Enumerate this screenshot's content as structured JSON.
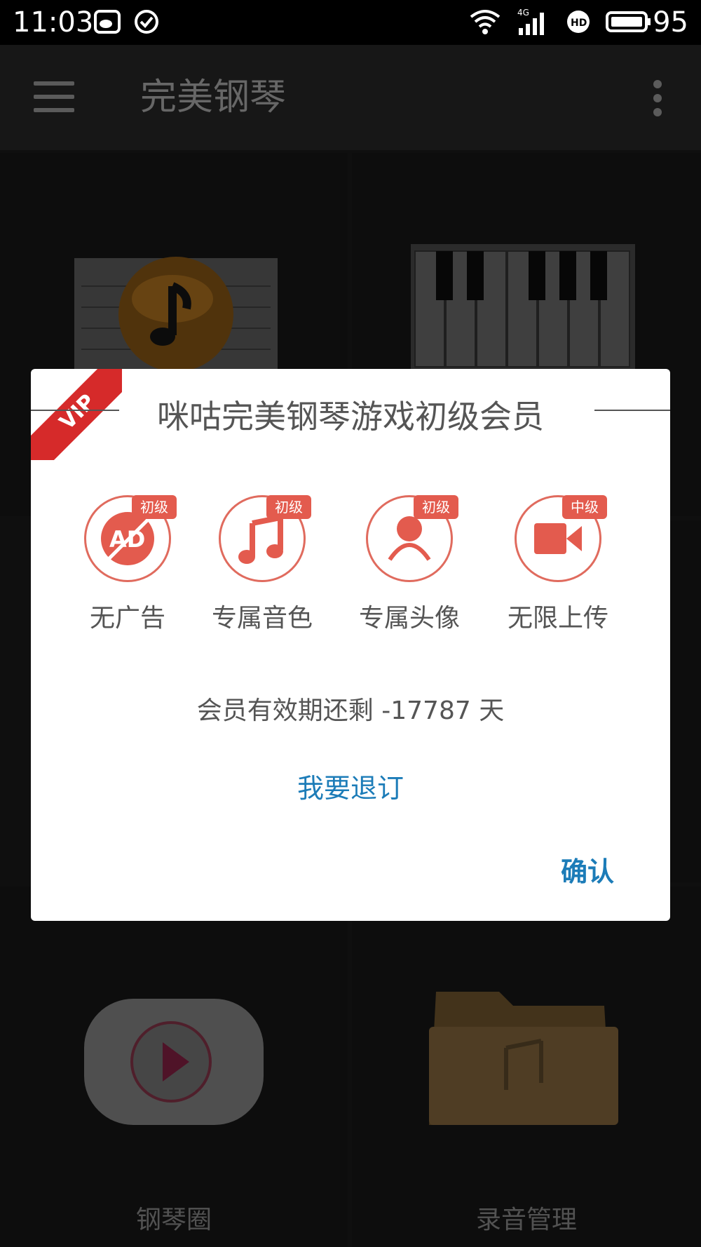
{
  "status_bar": {
    "time": "11:03",
    "battery": "95",
    "icons": [
      "weibo-icon",
      "check-circle-icon",
      "wifi-icon",
      "signal-4g-icon",
      "hd-icon",
      "battery-icon"
    ]
  },
  "app_bar": {
    "title": "完美钢琴"
  },
  "tiles": {
    "piano_circle": "钢琴圈",
    "recording": "录音管理"
  },
  "dialog": {
    "ribbon": "VIP",
    "title": "咪咕完美钢琴游戏初级会员",
    "benefits": [
      {
        "label": "无广告",
        "badge": "初级",
        "icon": "no-ad-icon"
      },
      {
        "label": "专属音色",
        "badge": "初级",
        "icon": "music-note-icon"
      },
      {
        "label": "专属头像",
        "badge": "初级",
        "icon": "avatar-icon"
      },
      {
        "label": "无限上传",
        "badge": "中级",
        "icon": "video-camera-icon"
      }
    ],
    "validity": "会员有效期还剩 -17787 天",
    "unsubscribe": "我要退订",
    "confirm": "确认"
  },
  "colors": {
    "accent_red": "#e35b4e",
    "link_blue": "#1c7cb8"
  }
}
